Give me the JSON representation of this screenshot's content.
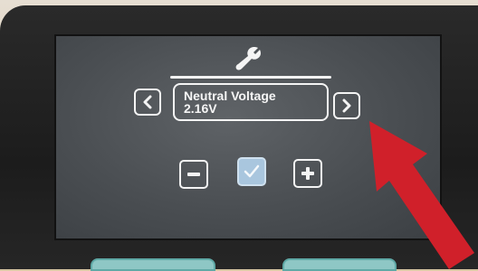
{
  "screen": {
    "title_icon": "wrench-icon",
    "parameter": {
      "name": "Neutral Voltage",
      "value": "2.16V"
    },
    "nav": {
      "prev_icon": "chevron-left-icon",
      "next_icon": "chevron-right-icon"
    },
    "controls": {
      "decrease_icon": "minus-icon",
      "confirm_icon": "check-icon",
      "increase_icon": "plus-icon"
    }
  },
  "overlay": {
    "pointer_icon": "red-arrow-icon",
    "pointer_color": "#d0202a"
  },
  "colors": {
    "screen_background": "#4f5357",
    "foreground": "#f4f4f4",
    "confirm_fill": "#a9c6de",
    "bezel": "#1e1e1e"
  }
}
